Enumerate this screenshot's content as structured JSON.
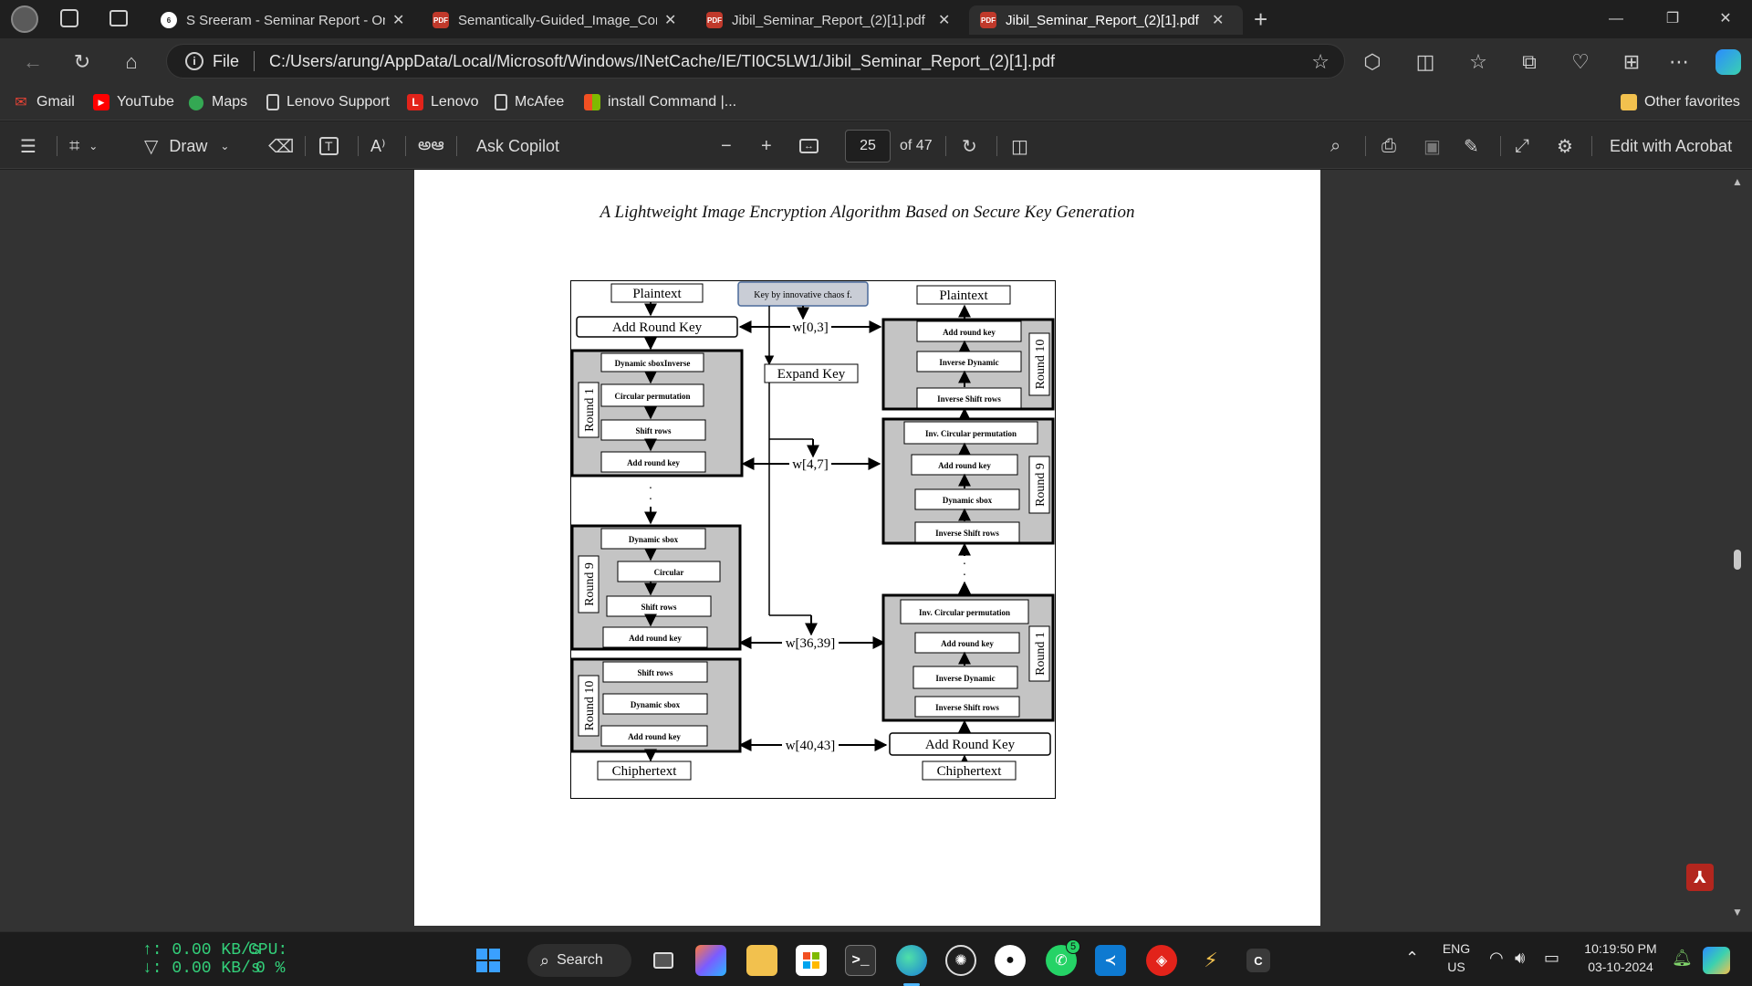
{
  "tabs": [
    {
      "title": "S Sreeram - Seminar Report - Onl",
      "icon": "tab-sreeram-icon",
      "active": false
    },
    {
      "title": "Semantically-Guided_Image_Com",
      "icon": "pdf-icon",
      "active": false
    },
    {
      "title": "Jibil_Seminar_Report_(2)[1].pdf",
      "icon": "pdf-icon",
      "active": false
    },
    {
      "title": "Jibil_Seminar_Report_(2)[1].pdf",
      "icon": "pdf-icon",
      "active": true
    }
  ],
  "address": {
    "scheme_label": "File",
    "url": "C:/Users/arung/AppData/Local/Microsoft/Windows/INetCache/IE/TI0C5LW1/Jibil_Seminar_Report_(2)[1].pdf"
  },
  "favorites": {
    "items": [
      "Gmail",
      "YouTube",
      "Maps",
      "Lenovo Support",
      "Lenovo",
      "McAfee",
      "install Command |..."
    ],
    "other": "Other favorites"
  },
  "pdf_toolbar": {
    "draw": "Draw",
    "ask_copilot": "Ask Copilot",
    "read_aloud_glyph": "A⁾",
    "translate_glyph": "అఆ",
    "page_current": "25",
    "page_total": "of 47",
    "edit_acrobat": "Edit with Acrobat"
  },
  "page": {
    "header": "A Lightweight Image Encryption Algorithm Based on Secure Key Generation"
  },
  "diagram": {
    "left_plaintext": "Plaintext",
    "right_plaintext": "Plaintext",
    "key_box": "Key by innovative chaos f.",
    "add_round_key_top": "Add Round Key",
    "expand_key": "Expand Key",
    "w_0_3": "w[0,3]",
    "w_4_7": "w[4,7]",
    "w_36_39": "w[36,39]",
    "w_40_43": "w[40,43]",
    "enc_round1": {
      "label": "Round 1",
      "steps": [
        "Dynamic sboxInverse",
        "Circular permutation",
        "Shift rows",
        "Add round key"
      ]
    },
    "enc_round9": {
      "label": "Round 9",
      "steps": [
        "Dynamic sbox",
        "Circular",
        "Shift rows",
        "Add round key"
      ]
    },
    "enc_round10": {
      "label": "Round 10",
      "steps": [
        "Shift rows",
        "Dynamic sbox",
        "Add round key"
      ]
    },
    "enc_output": "Chiphertext",
    "dec_round10": {
      "label": "Round 10",
      "steps": [
        "Add round key",
        "Inverse Dynamic",
        "Inverse Shift rows"
      ]
    },
    "dec_round9": {
      "label": "Round 9",
      "steps": [
        "Inv. Circular permutation",
        "Add round key",
        "Dynamic sbox",
        "Inverse Shift rows"
      ]
    },
    "dec_round1": {
      "label": "Round 1",
      "steps": [
        "Inv. Circular permutation",
        "Add round key",
        "Inverse Dynamic",
        "Inverse Shift rows"
      ]
    },
    "add_round_key_bottom": "Add Round Key",
    "dec_input": "Chiphertext"
  },
  "taskbar": {
    "net_up": "↑: 0.00 KB/s",
    "net_down": "↓: 0.00 KB/s",
    "cpu_label": "CPU:",
    "cpu_value": "0 %",
    "search": "Search",
    "whatsapp_badge": "5",
    "lang": "ENG",
    "region": "US",
    "time": "10:19:50 PM",
    "date": "03-10-2024"
  },
  "colors": {
    "accent": "#0078d4",
    "round_fill": "#c4c4c4",
    "key_box_fill": "#c9cdd6",
    "net_text": "#33d07a"
  }
}
